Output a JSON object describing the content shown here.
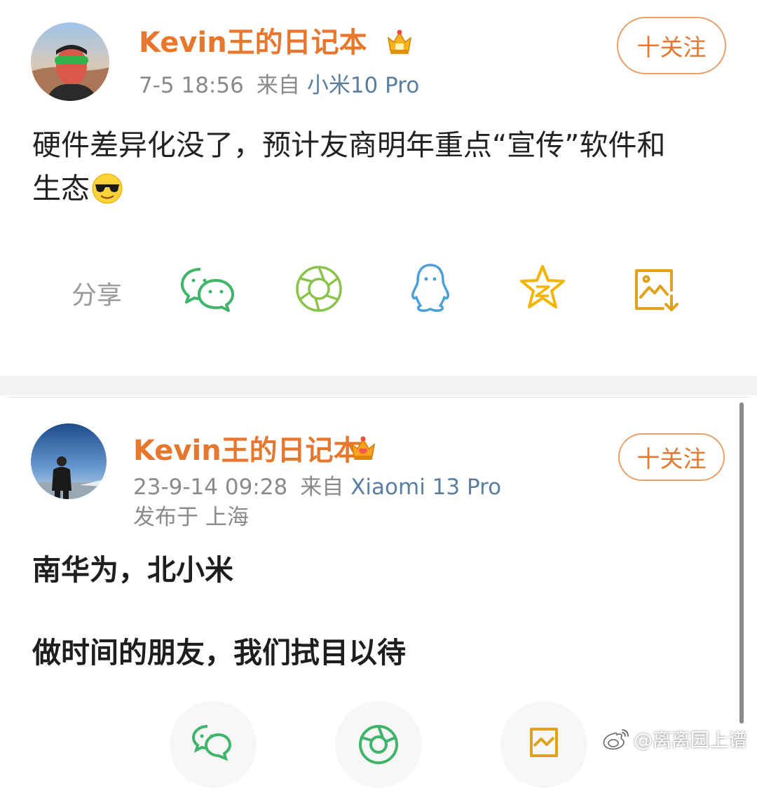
{
  "post1": {
    "username": "Kevin王的日记本",
    "badge_icon": "crown-vip-icon",
    "time": "7-5 18:56",
    "source_prefix": "来自",
    "source": "小米10 Pro",
    "follow_label": "十关注",
    "text_line1": "硬件差异化没了，预计友商明年重点“宣传”软件和",
    "text_line2": "生态",
    "emoji_icon": "cool-sunglasses-emoji-icon",
    "share_label": "分享",
    "share_icons": [
      "wechat-icon",
      "moments-icon",
      "qq-icon",
      "qzone-icon",
      "save-image-icon"
    ]
  },
  "post2": {
    "username": "Kevin王的日记本",
    "badge_icon": "crown-vip-icon",
    "time": "23-9-14 09:28",
    "source_prefix": "来自",
    "source": "Xiaomi 13 Pro",
    "location": "发布于 上海",
    "follow_label": "十关注",
    "text_line1": "南华为，北小米",
    "text_line2": "做时间的朋友，我们拭目以待",
    "bottom_icons": [
      "wechat-icon",
      "moments-icon",
      "save-image-icon"
    ]
  },
  "watermark": "@离离园上谱",
  "colors": {
    "username": "#e8772e",
    "source": "#5a7ea0",
    "wechat": "#3fb56a",
    "moments": "#8bc34a",
    "qq": "#4a9fd8",
    "qzone": "#f2b600",
    "save": "#e0a21a"
  }
}
